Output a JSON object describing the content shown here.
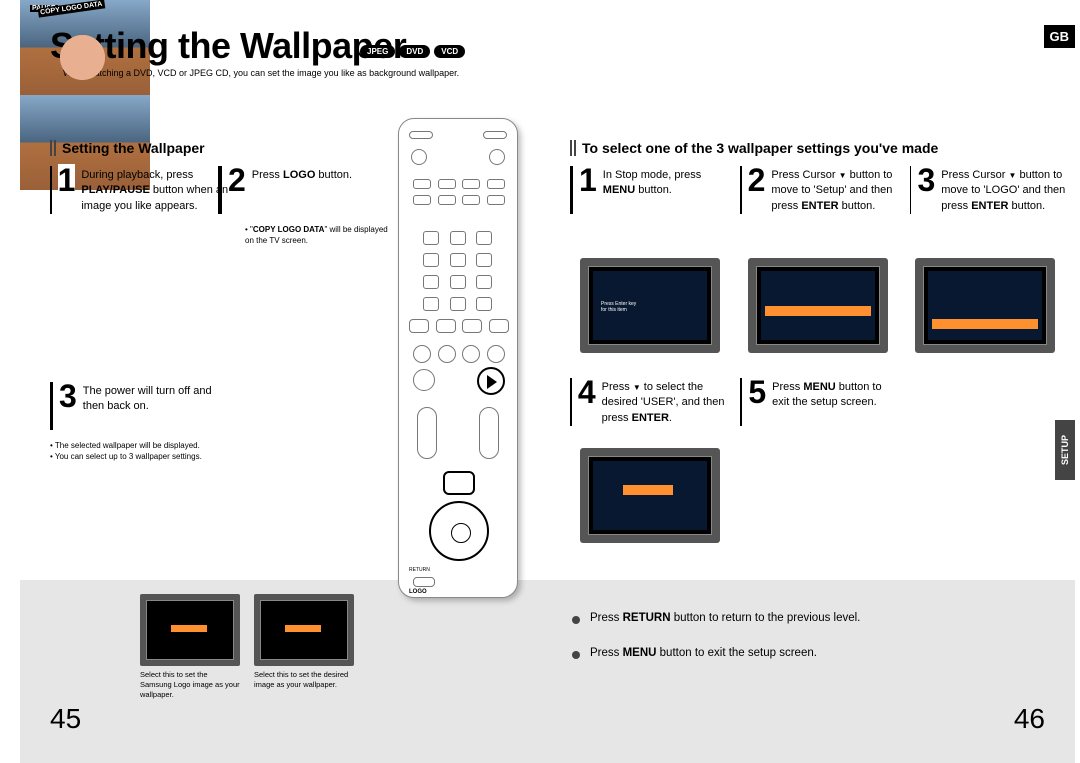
{
  "header": {
    "title": "Setting the Wallpaper",
    "badges": [
      "JPEG",
      "DVD",
      "VCD"
    ],
    "region": "GB",
    "intro": "While watching a DVD, VCD or JPEG CD, you can set the image you like as background wallpaper."
  },
  "left": {
    "subtitle": "Setting the Wallpaper",
    "step1": "During playback, press <b>PLAY/PAUSE</b> button when an image you like appears.",
    "step2": "Press <b>LOGO</b> button.",
    "step3": "The power will turn off and then back on.",
    "note1": "• \"<b>COPY LOGO DATA</b>\" will be displayed on the TV screen.",
    "note2": "• The selected wallpaper will be displayed.<br>• You can select up to 3 wallpaper settings.",
    "photo_label1": "PAUSE",
    "photo_label2": "COPY LOGO DATA"
  },
  "right": {
    "subtitle": "To select one of the 3 wallpaper settings you've made",
    "step1": "In Stop mode, press <b>MENU</b> button.",
    "step2": "Press Cursor <span class='dn-arrow'></span> button to move to 'Setup' and then press <b>ENTER</b> button.",
    "step3": "Press Cursor <span class='dn-arrow'></span> button to move to 'LOGO' and then press <b>ENTER</b> button.",
    "step4": "Press <span class='dn-arrow'></span> to select the desired 'USER', and then press <b>ENTER</b>.",
    "step5": "Press <b>MENU</b> button to exit the setup screen."
  },
  "bottom": {
    "cap1": "Select this to set the Samsung Logo image as your wallpaper.",
    "cap2": "Select this to set the desired image as your wallpaper.",
    "tip1": "Press <b>RETURN</b> button to return to the previous level.",
    "tip2": "Press <b>MENU</b> button to exit the setup screen."
  },
  "pages": {
    "left": "45",
    "right": "46"
  },
  "sidetab": "SETUP",
  "remote": {
    "logo_label": "LOGO",
    "return_label": "RETURN"
  }
}
